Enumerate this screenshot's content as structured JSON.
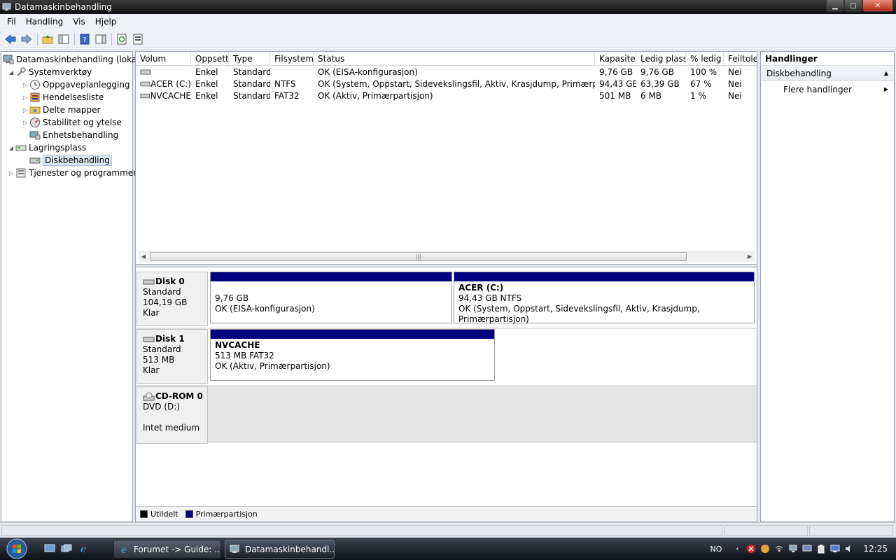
{
  "window": {
    "title": "Datamaskinbehandling"
  },
  "menu": [
    "Fil",
    "Handling",
    "Vis",
    "Hjelp"
  ],
  "tree": {
    "root": "Datamaskinbehandling (lokal)",
    "systemverktoy": "Systemverktøy",
    "oppgave": "Oppgaveplanlegging",
    "hendelse": "Hendelsesliste",
    "delte": "Delte mapper",
    "stabilitet": "Stabilitet og ytelse",
    "enhet": "Enhetsbehandling",
    "lagring": "Lagringsplass",
    "disk": "Diskbehandling",
    "tjenester": "Tjenester og programmer"
  },
  "list": {
    "columns": [
      "Volum",
      "Oppsett",
      "Type",
      "Filsystem",
      "Status",
      "Kapasitet",
      "Ledig plass",
      "% ledig",
      "Feiltoler"
    ],
    "rows": [
      [
        "",
        "Enkel",
        "Standard",
        "",
        "OK (EISA-konfigurasjon)",
        "9,76 GB",
        "9,76 GB",
        "100 %",
        "Nei"
      ],
      [
        "ACER (C:)",
        "Enkel",
        "Standard",
        "NTFS",
        "OK (System, Oppstart, Sidevekslingsfil, Aktiv, Krasjdump, Primærpartisjon)",
        "94,43 GB",
        "63,39 GB",
        "67 %",
        "Nei"
      ],
      [
        "NVCACHE",
        "Enkel",
        "Standard",
        "FAT32",
        "OK (Aktiv, Primærpartisjon)",
        "501 MB",
        "6 MB",
        "1 %",
        "Nei"
      ]
    ]
  },
  "disks": {
    "disk0": {
      "name": "Disk 0",
      "type": "Standard",
      "size": "104,19 GB",
      "state": "Klar"
    },
    "disk1": {
      "name": "Disk 1",
      "type": "Standard",
      "size": "513 MB",
      "state": "Klar"
    },
    "cd0": {
      "name": "CD-ROM 0",
      "type": "DVD (D:)",
      "state": "Intet medium"
    }
  },
  "partitions": {
    "p0a": {
      "size": "9,76 GB",
      "status": "OK (EISA-konfigurasjon)"
    },
    "p0b": {
      "name": "ACER  (C:)",
      "size": "94,43 GB NTFS",
      "status": "OK (System, Oppstart, Sidevekslingsfil, Aktiv, Krasjdump, Primærpartisjon)"
    },
    "p1a": {
      "name": "NVCACHE",
      "size": "513 MB FAT32",
      "status": "OK (Aktiv, Primærpartisjon)"
    }
  },
  "legend": {
    "unalloc": "Utildelt",
    "primary": "Primærpartisjon",
    "unalloc_color": "#000000",
    "primary_color": "#000080"
  },
  "actions": {
    "title": "Handlinger",
    "section": "Diskbehandling",
    "more": "Flere handlinger"
  },
  "taskbar": {
    "btn1": "Forumet -> Guide: ...",
    "btn2": "Datamaskinbehandl...",
    "lang": "NO",
    "clock": "12:25"
  }
}
